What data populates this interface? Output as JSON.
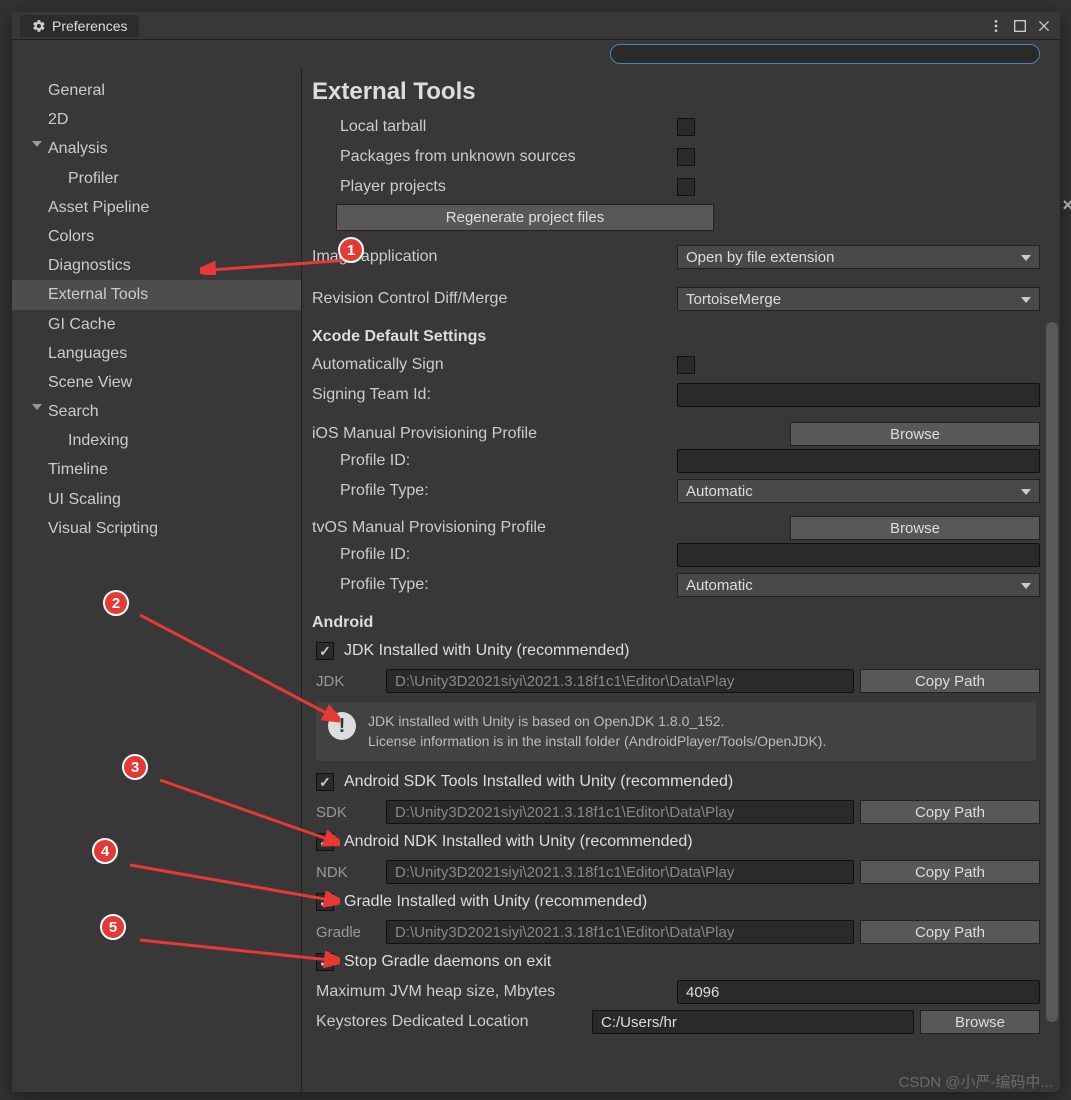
{
  "window": {
    "title": "Preferences"
  },
  "search": {
    "placeholder": ""
  },
  "sidebar": {
    "items": [
      {
        "label": "General",
        "level": 1
      },
      {
        "label": "2D",
        "level": 1
      },
      {
        "label": "Analysis",
        "level": 1,
        "expandable": true
      },
      {
        "label": "Profiler",
        "level": 2
      },
      {
        "label": "Asset Pipeline",
        "level": 1
      },
      {
        "label": "Colors",
        "level": 1
      },
      {
        "label": "Diagnostics",
        "level": 1
      },
      {
        "label": "External Tools",
        "level": 1,
        "selected": true
      },
      {
        "label": "GI Cache",
        "level": 1
      },
      {
        "label": "Languages",
        "level": 1
      },
      {
        "label": "Scene View",
        "level": 1
      },
      {
        "label": "Search",
        "level": 1,
        "expandable": true
      },
      {
        "label": "Indexing",
        "level": 2
      },
      {
        "label": "Timeline",
        "level": 1
      },
      {
        "label": "UI Scaling",
        "level": 1
      },
      {
        "label": "Visual Scripting",
        "level": 1
      }
    ]
  },
  "main": {
    "title": "External Tools",
    "local_tarball": "Local tarball",
    "packages_unknown": "Packages from unknown sources",
    "player_projects": "Player projects",
    "regenerate": "Regenerate project files",
    "image_app_label": "Image application",
    "image_app_value": "Open by file extension",
    "rev_label": "Revision Control Diff/Merge",
    "rev_value": "TortoiseMerge",
    "xcode_header": "Xcode Default Settings",
    "auto_sign": "Automatically Sign",
    "signing_team": "Signing Team Id:",
    "ios_header": "iOS Manual Provisioning Profile",
    "tvos_header": "tvOS Manual Provisioning Profile",
    "browse": "Browse",
    "profile_id": "Profile ID:",
    "profile_type": "Profile Type:",
    "profile_type_value": "Automatic",
    "android_header": "Android",
    "jdk_check": "JDK Installed with Unity (recommended)",
    "jdk_label": "JDK",
    "jdk_path": "D:\\Unity3D2021siyi\\2021.3.18f1c1\\Editor\\Data\\Play",
    "copy_path": "Copy Path",
    "jdk_info1": "JDK installed with Unity is based on OpenJDK 1.8.0_152.",
    "jdk_info2": "License information is in the install folder (AndroidPlayer/Tools/OpenJDK).",
    "sdk_check": "Android SDK Tools Installed with Unity (recommended)",
    "sdk_label": "SDK",
    "sdk_path": "D:\\Unity3D2021siyi\\2021.3.18f1c1\\Editor\\Data\\Play",
    "ndk_check": "Android NDK Installed with Unity (recommended)",
    "ndk_label": "NDK",
    "ndk_path": "D:\\Unity3D2021siyi\\2021.3.18f1c1\\Editor\\Data\\Play",
    "gradle_check": "Gradle Installed with Unity (recommended)",
    "gradle_label": "Gradle",
    "gradle_path": "D:\\Unity3D2021siyi\\2021.3.18f1c1\\Editor\\Data\\Play",
    "stop_gradle": "Stop Gradle daemons on exit",
    "max_jvm_label": "Maximum JVM heap size, Mbytes",
    "max_jvm_value": "4096",
    "keystore_label": "Keystores Dedicated Location",
    "keystore_value": "C:/Users/hr"
  },
  "annotations": {
    "b1": "1",
    "b2": "2",
    "b3": "3",
    "b4": "4",
    "b5": "5"
  },
  "watermark": "CSDN @小严-编码中..."
}
